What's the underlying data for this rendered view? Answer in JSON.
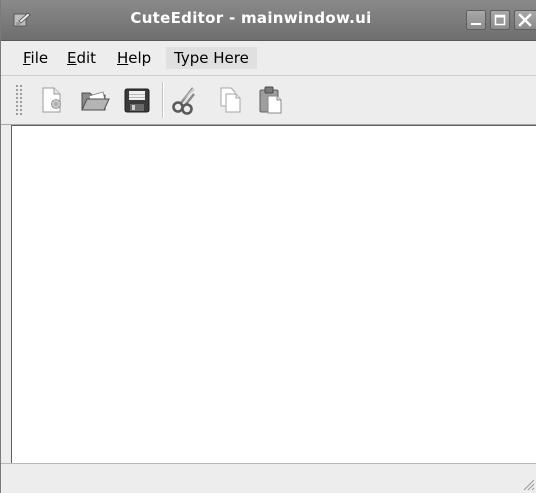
{
  "window": {
    "title": "CuteEditor - mainwindow.ui",
    "controls": [
      "minimize-icon",
      "maximize-icon",
      "close-icon"
    ]
  },
  "menubar": {
    "items": [
      {
        "label": "File",
        "mnemonic": "F",
        "rest": "ile"
      },
      {
        "label": "Edit",
        "mnemonic": "E",
        "rest": "dit"
      },
      {
        "label": "Help",
        "mnemonic": "H",
        "rest": "elp"
      },
      {
        "label": "Type Here"
      }
    ]
  },
  "toolbar": {
    "buttons": [
      {
        "name": "new-document-icon"
      },
      {
        "name": "open-folder-icon"
      },
      {
        "name": "save-icon"
      },
      {
        "name": "cut-icon"
      },
      {
        "name": "copy-icon"
      },
      {
        "name": "paste-icon"
      }
    ]
  },
  "colors": {
    "titlebar": "#7c7c7c",
    "window_bg": "#ededed",
    "content_bg": "#ffffff"
  }
}
